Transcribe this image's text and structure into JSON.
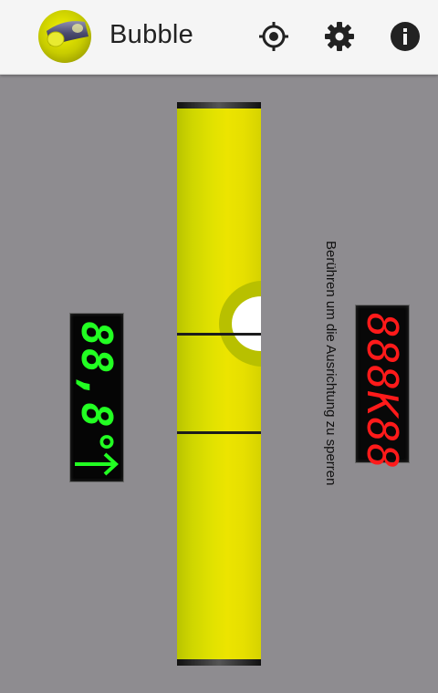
{
  "appbar": {
    "title": "Bubble",
    "icons": {
      "logo": "bubble-level-logo",
      "calibrate": "crosshair-icon",
      "settings": "gear-icon",
      "info": "info-icon"
    }
  },
  "level": {
    "angle_display": "88,8°",
    "direction_icon": "arrow-right-icon",
    "counter_display": "888K88",
    "hint": "Berühren um die Ausrichtung zu sperren"
  },
  "colors": {
    "background": "#8e8c90",
    "tube": "#e1e200",
    "angle_digits": "#22ff22",
    "counter_digits": "#ff1a1a"
  }
}
